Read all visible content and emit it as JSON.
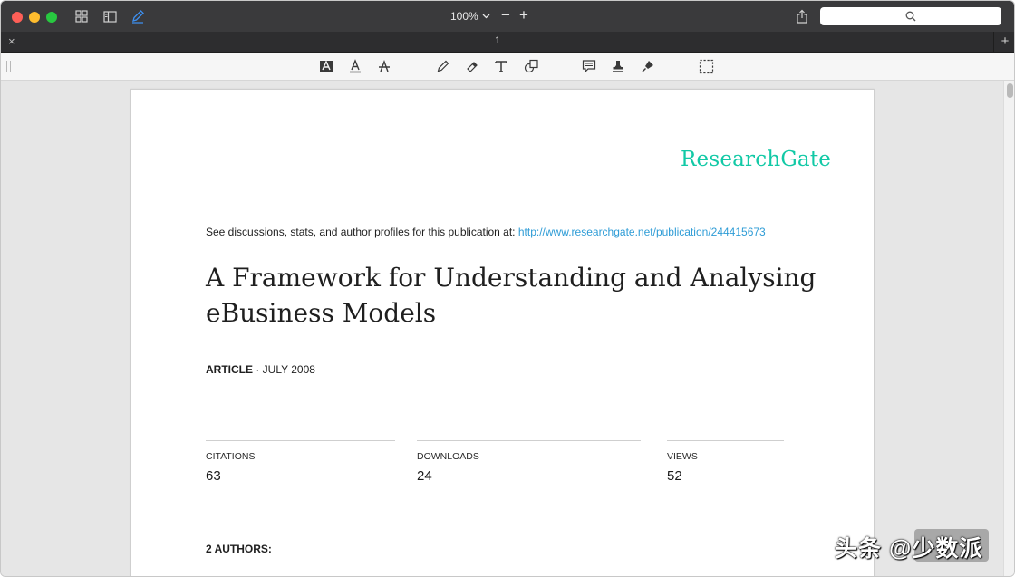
{
  "toolbar_top": {
    "zoom_value": "100%",
    "zoom_out": "−",
    "zoom_in": "+"
  },
  "tabbar": {
    "close_glyph": "×",
    "tab_title": "1",
    "add_glyph": "+"
  },
  "document": {
    "logo": "ResearchGate",
    "see_prefix": "See discussions, stats, and author profiles for this publication at: ",
    "see_link": "http://www.researchgate.net/publication/244415673",
    "title_line1": "A Framework for Understanding and Analysing",
    "title_line2": "eBusiness Models",
    "article_label": "ARTICLE",
    "article_date": " · JULY 2008",
    "stats": [
      {
        "label": "CITATIONS",
        "value": "63"
      },
      {
        "label": "DOWNLOADS",
        "value": "24"
      },
      {
        "label": "VIEWS",
        "value": "52"
      }
    ],
    "authors_label": "2 AUTHORS:"
  },
  "watermark": "头条 @少数派",
  "colors": {
    "brand_green": "#12c9a6",
    "link_blue": "#2e9cd6",
    "titlebar": "#3a3a3c"
  }
}
